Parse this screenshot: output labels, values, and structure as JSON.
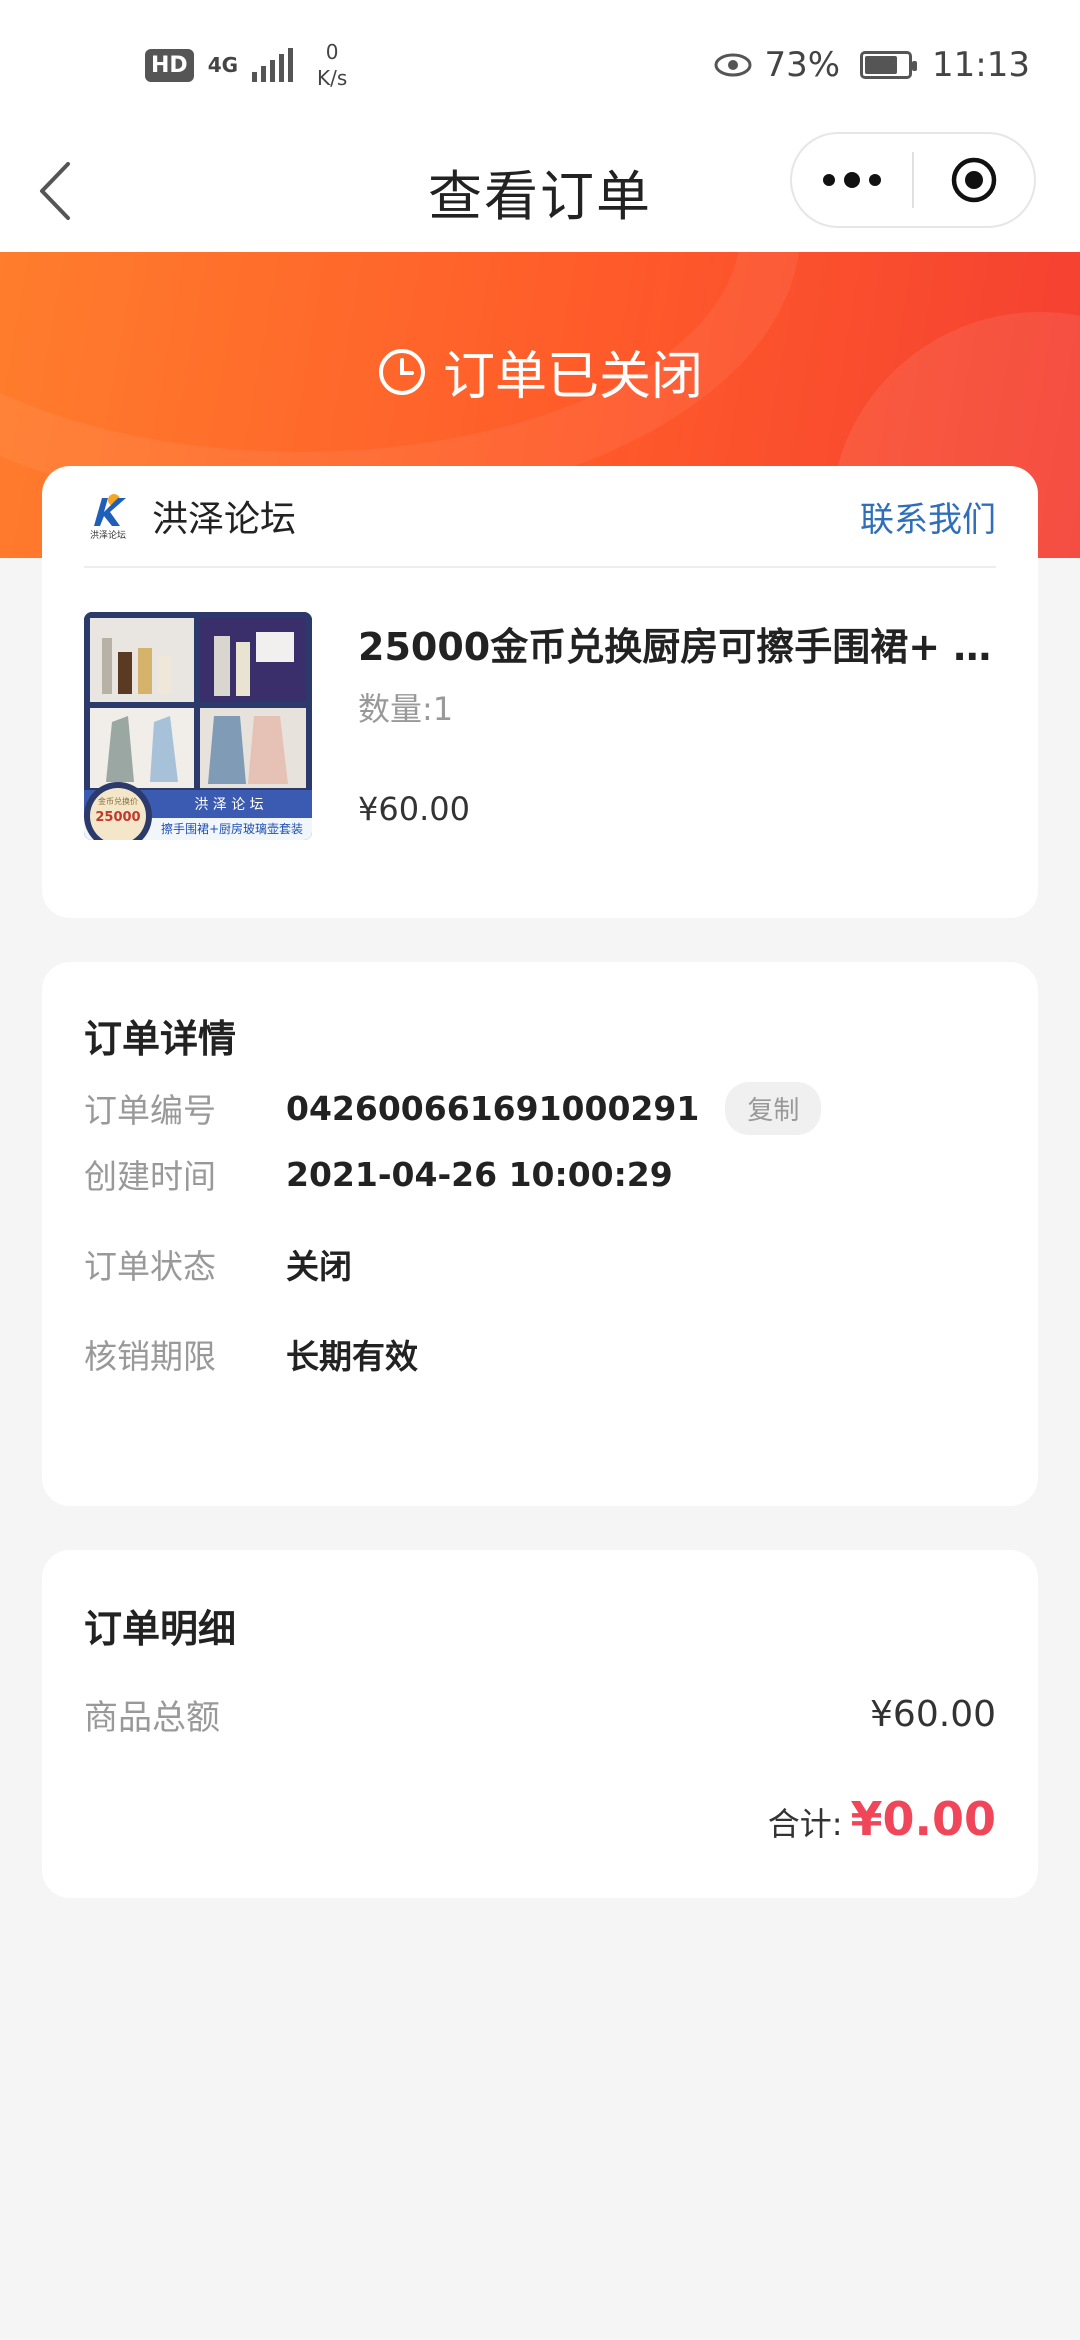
{
  "status_bar": {
    "hd": "HD",
    "network": "4G",
    "speed_value": "0",
    "speed_unit": "K/s",
    "battery_percent": "73%",
    "time": "11:13"
  },
  "nav": {
    "title": "查看订单"
  },
  "order_status": {
    "text": "订单已关闭"
  },
  "shop": {
    "logo_text": "洪泽论坛",
    "name": "洪泽论坛",
    "contact_label": "联系我们"
  },
  "product": {
    "title": "25000金币兑换厨房可擦手围裙+ …",
    "quantity": "数量:1",
    "price": "¥60.00",
    "thumb": {
      "badge_line1": "金币兑换价",
      "badge_value": "25000",
      "brand": "洪 泽 论 坛",
      "caption": "擦手围裙+厨房玻璃壶套装"
    }
  },
  "detail": {
    "title": "订单详情",
    "rows": [
      {
        "label": "订单编号",
        "value": "042600661691000291"
      },
      {
        "label": "创建时间",
        "value": "2021-04-26 10:00:29"
      },
      {
        "label": "订单状态",
        "value": "关闭"
      },
      {
        "label": "核销期限",
        "value": "长期有效"
      }
    ],
    "copy_label": "复制"
  },
  "bill": {
    "title": "订单明细",
    "subtotal_label": "商品总额",
    "subtotal_value": "¥60.00",
    "total_label": "合计:",
    "total_value": "¥0.00"
  },
  "colors": {
    "hero_start": "#ff7d2c",
    "hero_end": "#f43f32",
    "link": "#2f6fba",
    "total": "#f0465a"
  }
}
